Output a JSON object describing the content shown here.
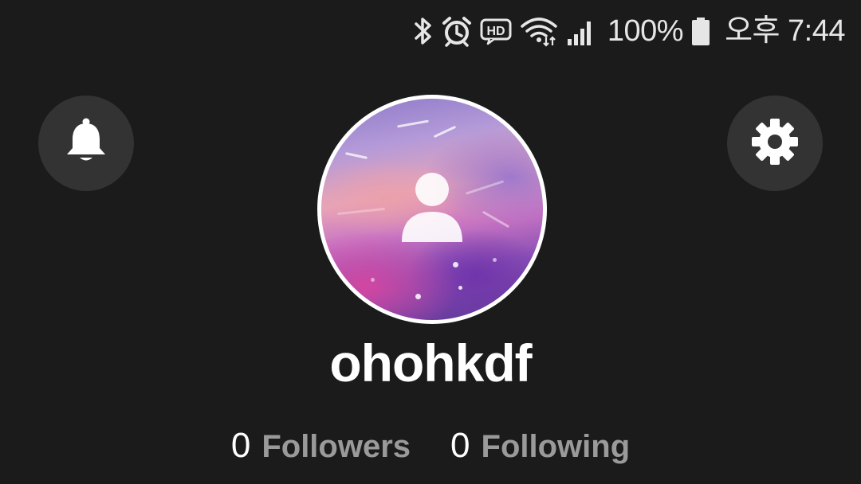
{
  "status_bar": {
    "battery_percent": "100%",
    "time": "오후 7:44",
    "icons": [
      "bluetooth-icon",
      "alarm-icon",
      "hd-voice-icon",
      "wifi-icon",
      "signal-icon",
      "battery-icon"
    ]
  },
  "header": {
    "left_button_icon": "bell-icon",
    "right_button_icon": "gear-icon"
  },
  "profile": {
    "avatar_icon": "person-icon",
    "username": "ohohkdf"
  },
  "stats": [
    {
      "count": "0",
      "label": "Followers"
    },
    {
      "count": "0",
      "label": "Following"
    }
  ],
  "colors": {
    "background": "#1b1b1b",
    "button_bg": "#333333",
    "text_primary": "#ffffff",
    "text_secondary": "#9a9a9a"
  }
}
